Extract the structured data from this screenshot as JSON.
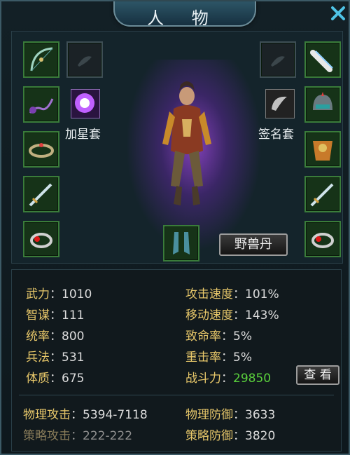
{
  "window": {
    "title": "人 物",
    "close_icon": "close-x-icon"
  },
  "equipment": {
    "left_slots": [
      "bow-weapon-icon",
      "chain-whip-icon",
      "bracelet-icon",
      "sword-icon",
      "ring-icon"
    ],
    "right_slots": [
      "scroll-icon",
      "helmet-icon",
      "armor-icon",
      "sword-icon",
      "ring-icon"
    ],
    "center_slot": "boots-icon",
    "set_left": {
      "icon": "glowing-gem-icon",
      "label": "加星套"
    },
    "set_right": {
      "icon": "grey-gem-icon",
      "label": "签名套"
    },
    "beast_button": "野兽丹"
  },
  "stats": {
    "left": [
      {
        "key": "武力",
        "value": "1010"
      },
      {
        "key": "智谋",
        "value": "111"
      },
      {
        "key": "统率",
        "value": "800"
      },
      {
        "key": "兵法",
        "value": "531"
      },
      {
        "key": "体质",
        "value": "675"
      }
    ],
    "right": [
      {
        "key": "攻击速度",
        "value": "101%"
      },
      {
        "key": "移动速度",
        "value": "143%"
      },
      {
        "key": "致命率",
        "value": "5%"
      },
      {
        "key": "重击率",
        "value": "5%"
      },
      {
        "key": "战斗力",
        "value": "29850"
      }
    ],
    "view_button": "查 看",
    "physical_attack": {
      "key": "物理攻击",
      "value": "5394-7118"
    },
    "strategy_attack": {
      "key": "策略攻击",
      "value": "222-222"
    },
    "physical_defense": {
      "key": "物理防御",
      "value": "3633"
    },
    "strategy_defense": {
      "key": "策略防御",
      "value": "3820"
    }
  },
  "colors": {
    "stat_key": "#e8c86a",
    "power_value": "#5ad13c",
    "slot_border": "#3a7c3a"
  }
}
